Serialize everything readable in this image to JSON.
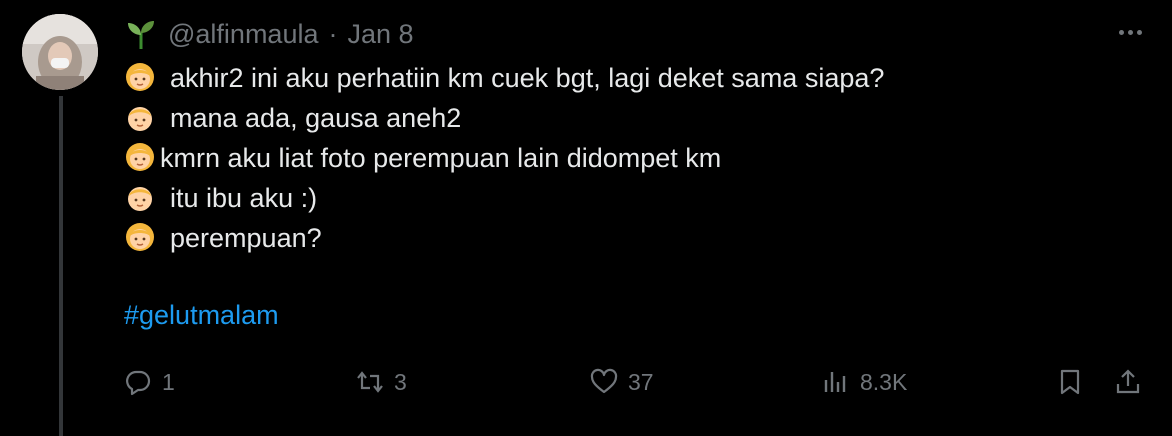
{
  "tweet": {
    "author_handle": "@alfinmaula",
    "separator": "·",
    "date": "Jan 8",
    "lines": [
      {
        "emoji": "girl-emoji",
        "text": "akhir2 ini aku perhatiin km cuek bgt, lagi deket sama siapa?"
      },
      {
        "emoji": "boy-emoji",
        "text": "mana ada, gausa aneh2"
      },
      {
        "emoji": "girl-emoji",
        "text": "kmrn aku liat foto perempuan lain didompet km"
      },
      {
        "emoji": "boy-emoji",
        "text": "itu ibu aku :)"
      },
      {
        "emoji": "girl-emoji",
        "text": "perempuan?"
      }
    ],
    "hashtag": "#gelutmalam"
  },
  "actions": {
    "replies": "1",
    "retweets": "3",
    "likes": "37",
    "views": "8.3K"
  },
  "colors": {
    "background": "#000000",
    "text": "#e7e9ea",
    "muted": "#71767b",
    "link": "#1d9bf0",
    "thread_line": "#333639"
  }
}
